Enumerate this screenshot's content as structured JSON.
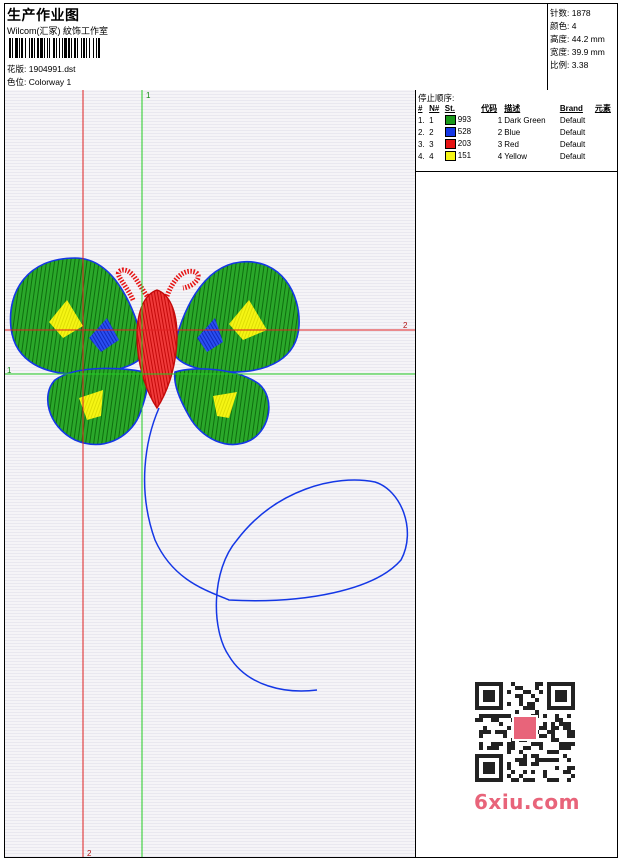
{
  "header": {
    "title": "生产作业图",
    "company": "Wilcom(汇冢) 紋饰工作室",
    "design_label": "花版:",
    "design_value": "1904991.dst",
    "color_label": "色位:",
    "color_value": "Colorway 1"
  },
  "stats": {
    "stitches_label": "针数:",
    "stitches_value": "1878",
    "colors_label": "颜色:",
    "colors_value": "4",
    "height_label": "高度:",
    "height_value": "44.2 mm",
    "width_label": "宽度:",
    "width_value": "39.9 mm",
    "scale_label": "比例:",
    "scale_value": "3.38"
  },
  "stop_sequence": {
    "title": "停止顺序:",
    "columns": [
      "#",
      "N#",
      "St.",
      "代码",
      "描述",
      "Brand",
      "元素"
    ],
    "rows": [
      {
        "idx": "1.",
        "n": "1",
        "color": "#1a9a1a",
        "st": "993",
        "code": "1",
        "desc": "Dark Green",
        "brand": "Default"
      },
      {
        "idx": "2.",
        "n": "2",
        "color": "#1437e6",
        "st": "528",
        "code": "2",
        "desc": "Blue",
        "brand": "Default"
      },
      {
        "idx": "3.",
        "n": "3",
        "color": "#e61414",
        "st": "203",
        "code": "3",
        "desc": "Red",
        "brand": "Default"
      },
      {
        "idx": "4.",
        "n": "4",
        "color": "#f5f514",
        "st": "151",
        "code": "4",
        "desc": "Yellow",
        "brand": "Default"
      }
    ]
  },
  "guides": {
    "v1": "1",
    "v2": "2",
    "h1": "1",
    "h2": "2"
  },
  "colors": {
    "green_guide": "#22cc22",
    "red_guide": "#e02020",
    "green": "#1a9a1a",
    "blue": "#1437e6",
    "red": "#e61414",
    "yellow": "#f5f514",
    "watermark": "#e8647a"
  },
  "watermark": "6xiu.com"
}
